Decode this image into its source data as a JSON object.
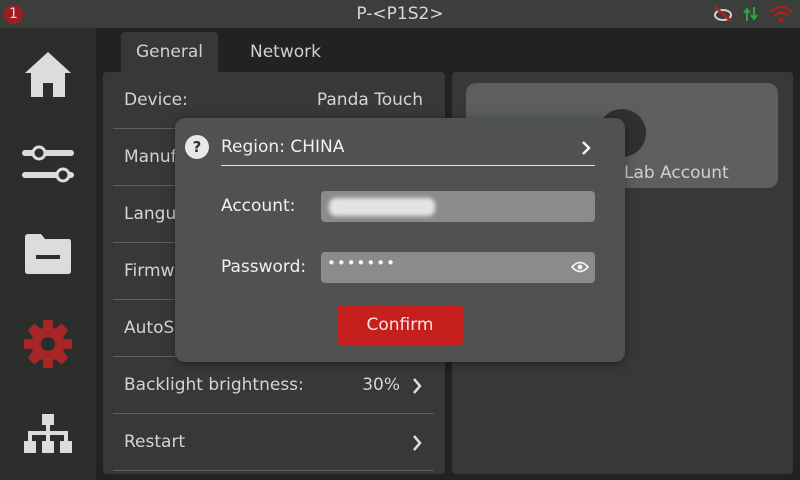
{
  "status_bar": {
    "notification_count": "1",
    "title": "P-<P1S2>",
    "icons": [
      "camera-off-icon",
      "transfer-arrows-icon",
      "wifi-off-icon"
    ]
  },
  "sidebar": {
    "items": [
      {
        "icon": "home-icon",
        "active": false
      },
      {
        "icon": "sliders-icon",
        "active": false
      },
      {
        "icon": "folder-icon",
        "active": false
      },
      {
        "icon": "gear-icon",
        "active": true
      },
      {
        "icon": "network-icon",
        "active": false
      }
    ]
  },
  "tabs": [
    {
      "label": "General",
      "active": true
    },
    {
      "label": "Network",
      "active": false
    }
  ],
  "settings": {
    "rows": [
      {
        "label": "Device:",
        "value": "Panda Touch"
      },
      {
        "label": "Manuf"
      },
      {
        "label": "Langu"
      },
      {
        "label": "Firmw"
      },
      {
        "label": "AutoSl"
      },
      {
        "label": "Backlight brightness:",
        "value": "30%"
      },
      {
        "label": "Restart"
      }
    ]
  },
  "account_card": {
    "label": "Lab Account"
  },
  "modal": {
    "region_label": "Region: CHINA",
    "account_label": "Account:",
    "password_label": "Password:",
    "password_mask": "•••••••",
    "confirm_label": "Confirm"
  },
  "colors": {
    "accent_red": "#c6201e",
    "active_icon": "#a82628",
    "icon_gray": "#dcdcdc"
  }
}
